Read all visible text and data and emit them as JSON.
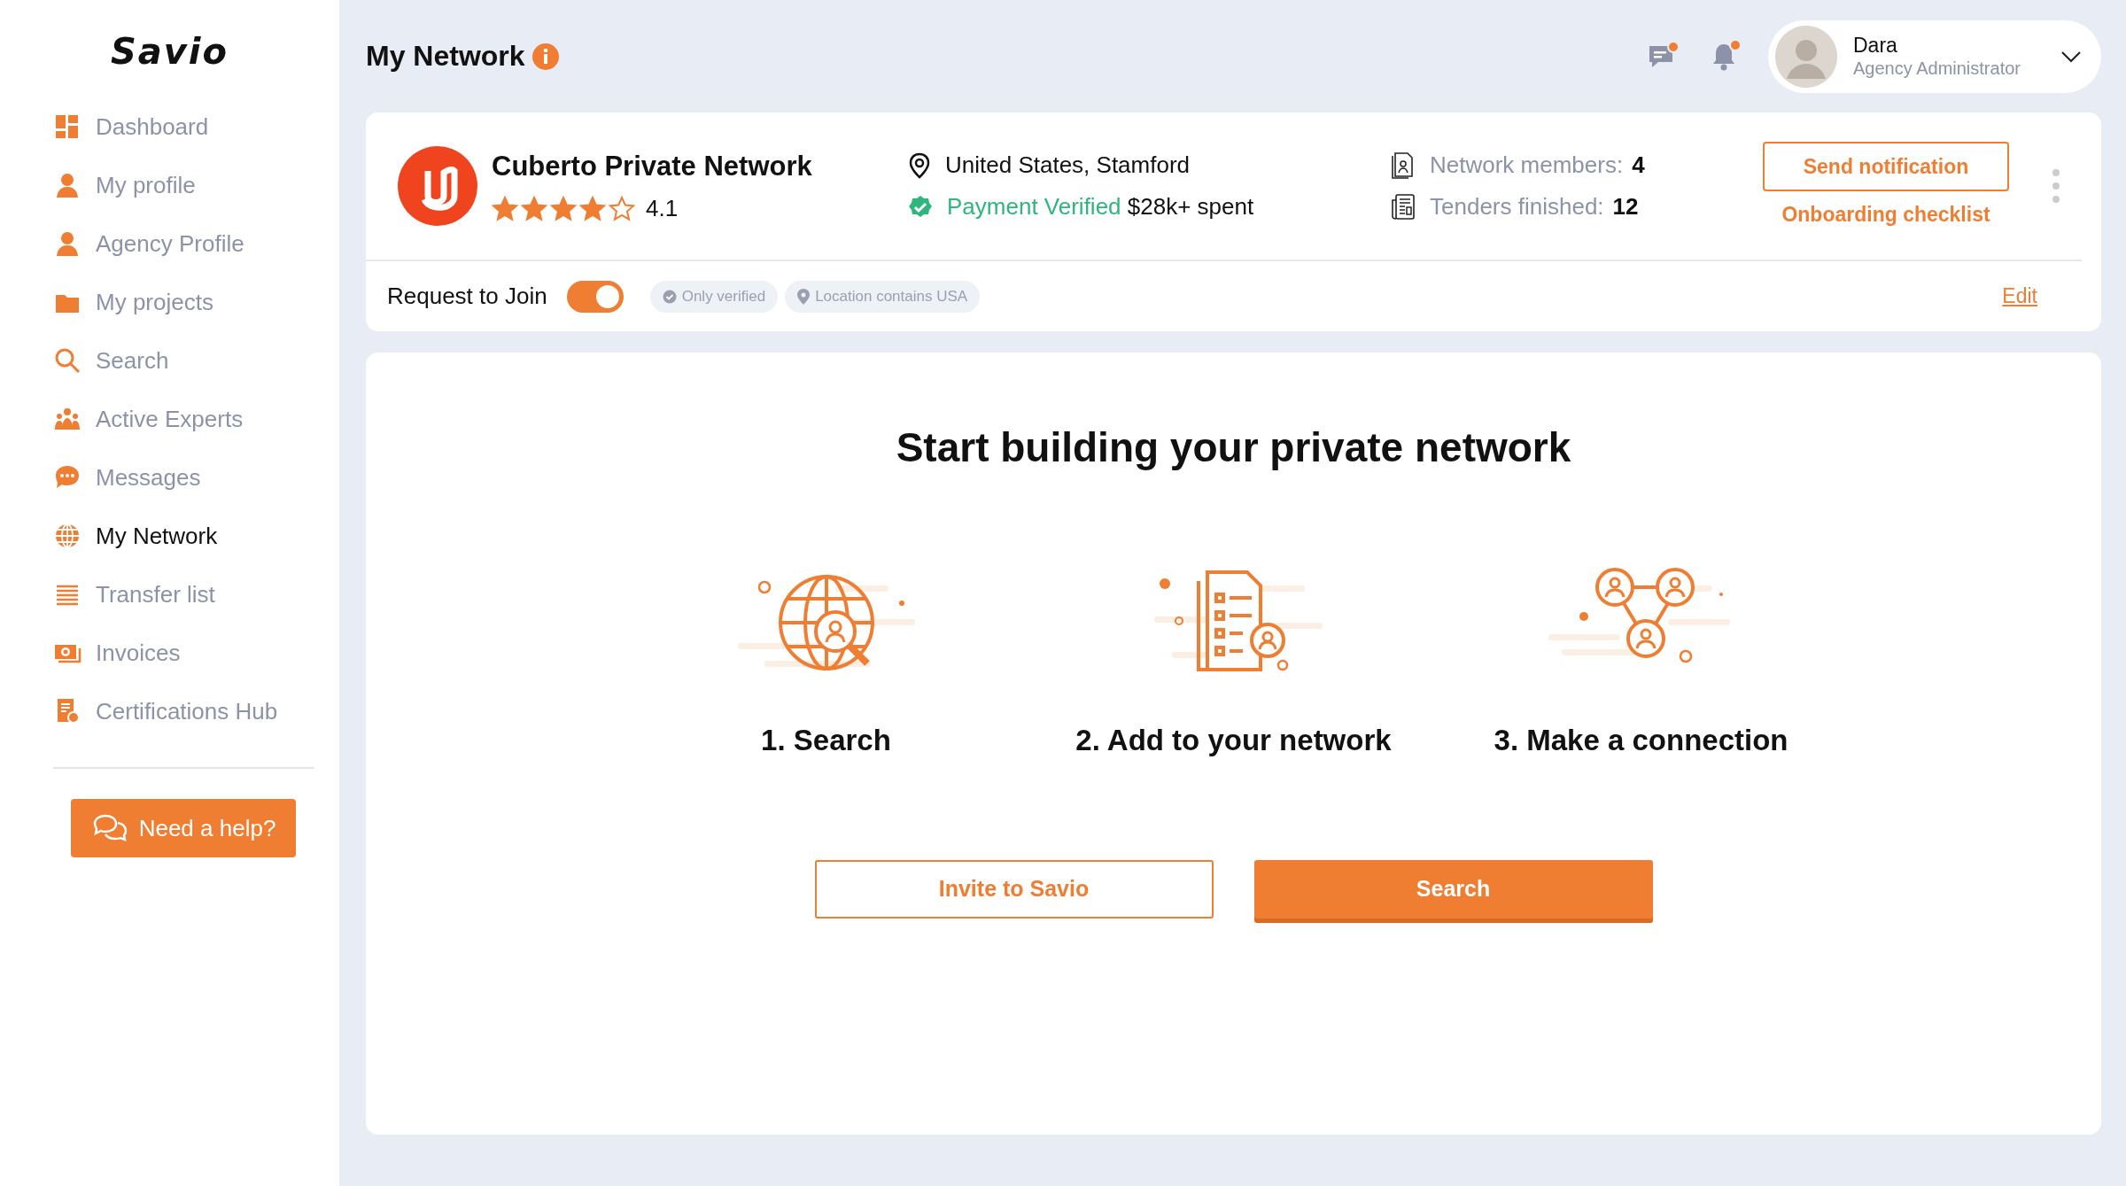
{
  "sidebar": {
    "logo": "Savio",
    "items": [
      {
        "label": "Dashboard",
        "selected": false
      },
      {
        "label": "My profile",
        "selected": false
      },
      {
        "label": "Agency Profile",
        "selected": false
      },
      {
        "label": "My projects",
        "selected": false
      },
      {
        "label": "Search",
        "selected": false
      },
      {
        "label": "Active Experts",
        "selected": false
      },
      {
        "label": "Messages",
        "selected": false
      },
      {
        "label": "My Network",
        "selected": true
      },
      {
        "label": "Transfer list",
        "selected": false
      },
      {
        "label": "Invoices",
        "selected": false
      },
      {
        "label": "Certifications Hub",
        "selected": false
      }
    ],
    "help_button": "Need a help?"
  },
  "header": {
    "title": "My Network",
    "messages_unread": true,
    "notifications_unread": true,
    "user": {
      "name": "Dara",
      "role": "Agency Administrator"
    }
  },
  "network": {
    "name": "Cuberto Private Network",
    "stars": 4,
    "rating": "4.1",
    "location": "United States, Stamford",
    "payment_status": "Payment Verified",
    "spent": "$28k+ spent",
    "stats": [
      {
        "label": "Network members:",
        "value": "4"
      },
      {
        "label": "Tenders finished:",
        "value": "12"
      }
    ],
    "send_button": "Send notification",
    "checklist_link": "Onboarding checklist",
    "request_to_join": {
      "label": "Request to Join",
      "on": true
    },
    "filters": [
      "Only verified",
      "Location contains USA"
    ],
    "edit_link": "Edit"
  },
  "empty_state": {
    "title": "Start building your private network",
    "steps": [
      "1. Search",
      "2. Add to your network",
      "3. Make a connection"
    ],
    "invite_button": "Invite to Savio",
    "search_button": "Search"
  }
}
